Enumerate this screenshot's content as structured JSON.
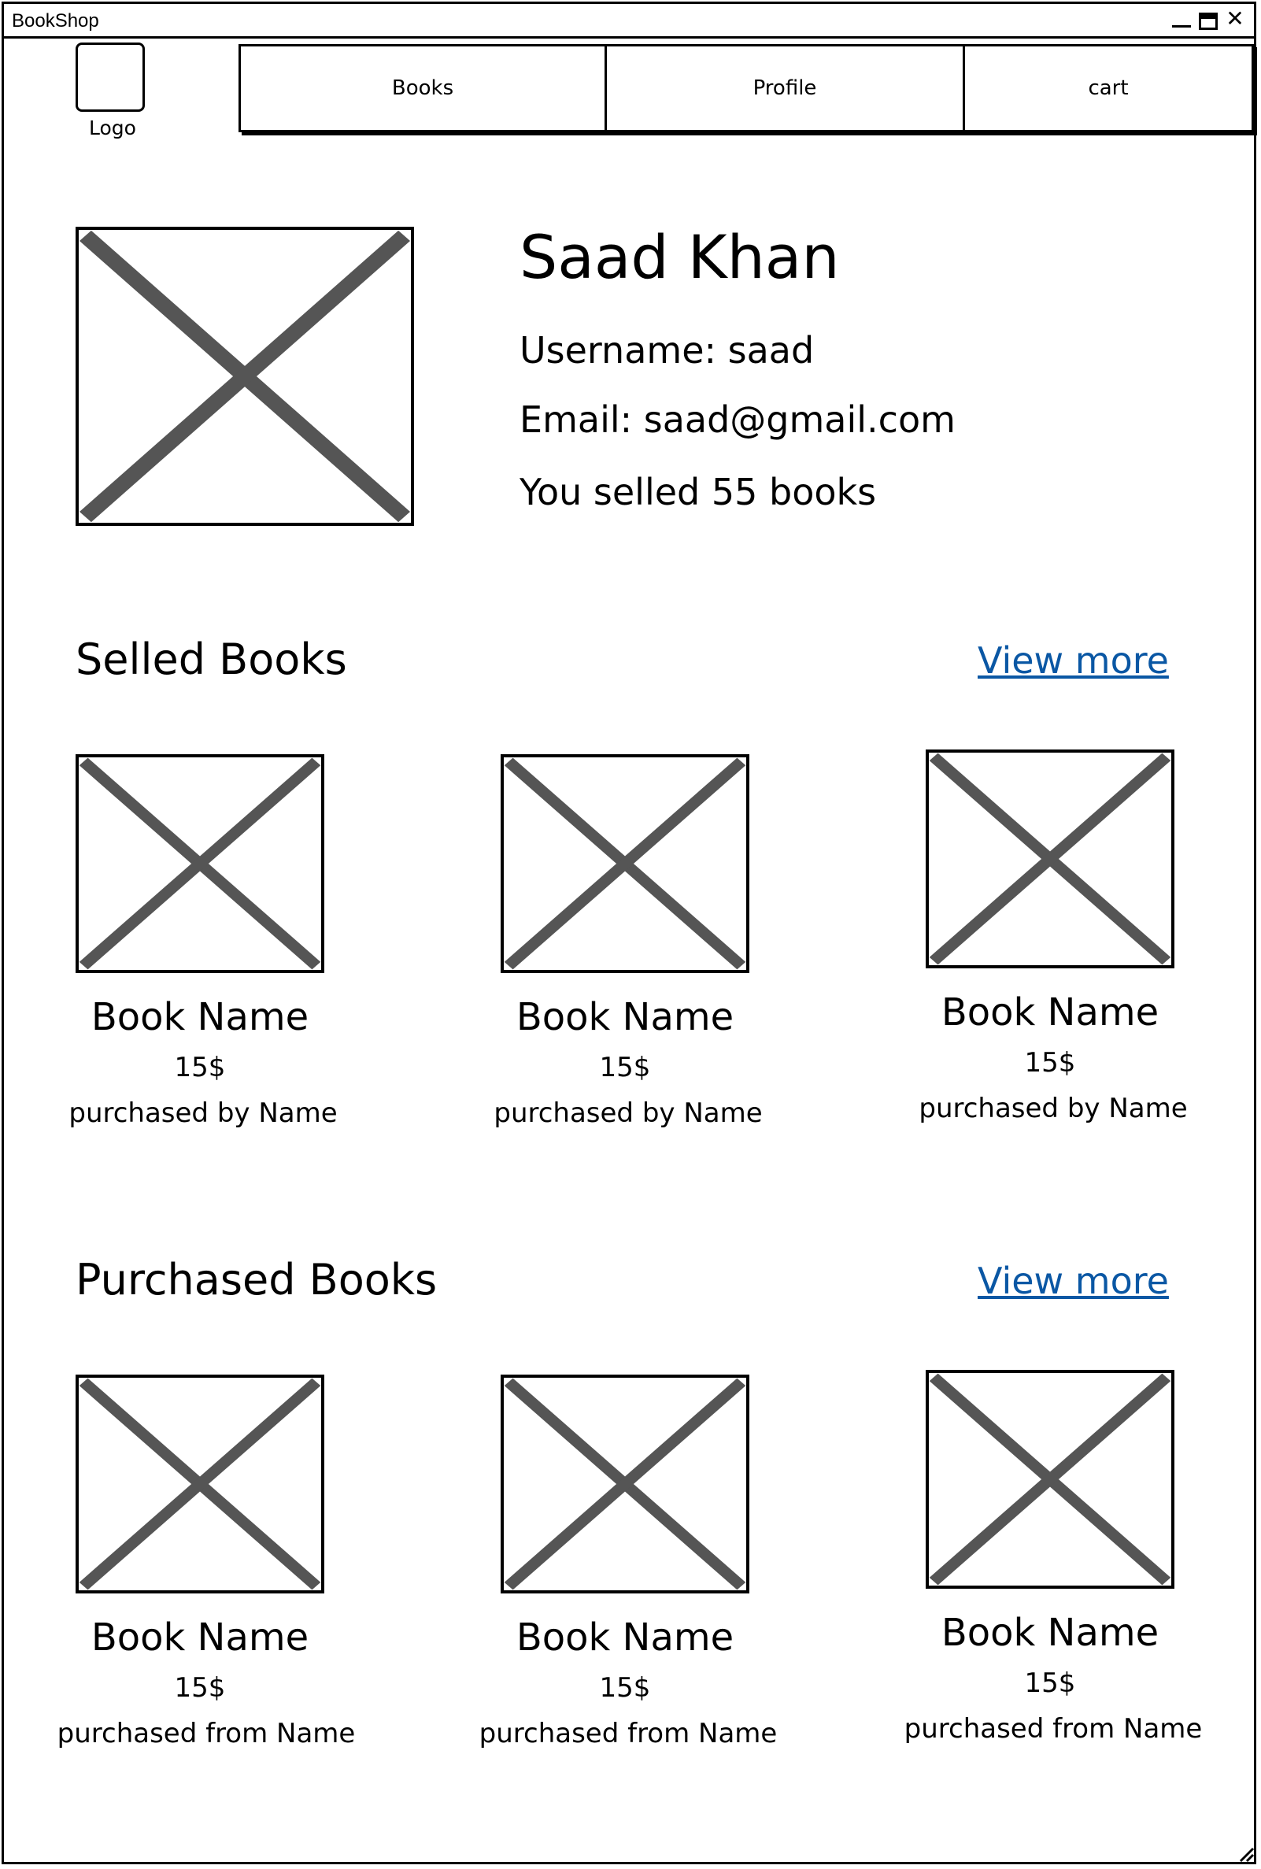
{
  "window": {
    "title": "BookShop"
  },
  "header": {
    "logo_label": "Logo",
    "nav": [
      {
        "label": "Books"
      },
      {
        "label": "Profile"
      },
      {
        "label": "cart"
      }
    ]
  },
  "profile": {
    "name": "Saad Khan",
    "username": "Username: saad",
    "email": "Email: saad@gmail.com",
    "sold_count": "You selled 55 books"
  },
  "selled_section": {
    "title": "Selled Books",
    "view_more": "View more",
    "books": [
      {
        "name": "Book Name",
        "price": "15$",
        "by": "purchased by Name"
      },
      {
        "name": "Book Name",
        "price": "15$",
        "by": "purchased by Name"
      },
      {
        "name": "Book Name",
        "price": "15$",
        "by": "purchased by Name"
      }
    ]
  },
  "purchased_section": {
    "title": "Purchased Books",
    "view_more": "View more",
    "books": [
      {
        "name": "Book Name",
        "price": "15$",
        "by": "purchased from Name"
      },
      {
        "name": "Book Name",
        "price": "15$",
        "by": "purchased from Name"
      },
      {
        "name": "Book Name",
        "price": "15$",
        "by": "purchased from Name"
      }
    ]
  },
  "colors": {
    "link": "#0a57a4",
    "placeholder_cross": "#555555"
  }
}
